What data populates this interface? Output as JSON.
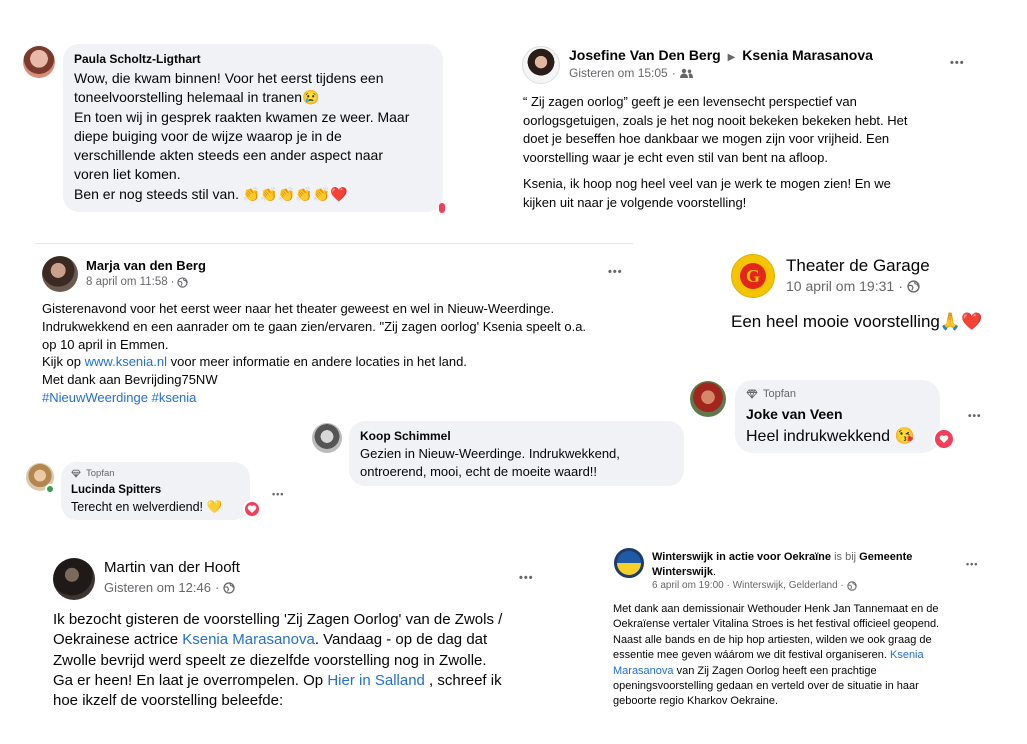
{
  "paula": {
    "name": "Paula Scholtz-Ligthart",
    "lines": [
      "Wow, die kwam binnen! Voor het eerst tijdens een",
      "toneelvoorstelling helemaal in tranen😢",
      "En toen wij in gesprek raakten kwamen ze weer. Maar",
      "diepe buiging voor de wijze waarop je in de",
      "verschillende akten steeds een ander aspect naar",
      "voren liet komen.",
      "Ben er nog steeds stil van. 👏👏👏👏👏❤️"
    ]
  },
  "josefine": {
    "author": "Josefine Van Den Berg",
    "target": "Ksenia Marasanova",
    "time": "Gisteren om 15:05",
    "dots": "•••",
    "lines": [
      "“ Zij zagen oorlog” geeft je een levensecht perspectief van",
      "oorlogsgetuigen, zoals je het nog nooit bekeken bekeken hebt. Het",
      "doet je beseffen hoe dankbaar we mogen zijn voor vrijheid. Een",
      "voorstelling waar je echt even stil van bent na afloop."
    ],
    "lines2": [
      "Ksenia, ik hoop nog heel veel van je werk te mogen zien! En we",
      "kijken uit naar je volgende voorstelling!"
    ]
  },
  "marja": {
    "name": "Marja van den Berg",
    "time": "8 april om 11:58",
    "dots": "•••",
    "line1": "Gisterenavond voor het eerst weer naar het theater geweest en wel in Nieuw-Weerdinge.",
    "line2": "Indrukwekkend en een aanrader om te gaan zien/ervaren. \"Zij zagen oorlog' Ksenia speelt o.a.",
    "line3": "op 10 april in Emmen.",
    "line4_pre": "Kijk op ",
    "line4_link": "www.ksenia.nl",
    "line4_post": " voor meer informatie en andere locaties in het land.",
    "line5": "Met dank aan Bevrijding75NW",
    "hashtags": "#NieuwWeerdinge #ksenia"
  },
  "theater": {
    "name": "Theater de Garage",
    "time": "10 april om 19:31",
    "text": "Een heel mooie voorstelling🙏❤️"
  },
  "joke": {
    "badge": "Topfan",
    "name": "Joke van Veen",
    "text": "Heel indrukwekkend 😘",
    "dots": "•••"
  },
  "koop": {
    "name": "Koop Schimmel",
    "line1": "Gezien in Nieuw-Weerdinge. Indrukwekkend,",
    "line2": "ontroerend, mooi, echt de moeite waard!!"
  },
  "lucinda": {
    "badge": "Topfan",
    "name": "Lucinda Spitters",
    "text": "Terecht en welverdiend! 💛",
    "dots": "•••"
  },
  "martin": {
    "name": "Martin van der Hooft",
    "time": "Gisteren om 12:46",
    "dots": "•••",
    "line1": "Ik bezocht gisteren de voorstelling 'Zij Zagen Oorlog' van de Zwols /",
    "line2_pre": "Oekrainese actrice ",
    "line2_link": "Ksenia Marasanova",
    "line2_post": ". Vandaag  - op de dag dat",
    "line3": "Zwolle bevrijd werd speelt ze diezelfde voorstelling nog in Zwolle.",
    "line4_pre": "Ga er heen! En laat je overrompelen. Op ",
    "line4_link": "Hier in Salland",
    "line4_post": " , schreef ik",
    "line5": "hoe ikzelf de voorstelling beleefde:"
  },
  "winterswijk": {
    "page": "Winterswijk in actie voor Oekraïne",
    "is_bij": " is bij ",
    "place": "Gemeente",
    "place2": "Winterswijk",
    "meta": "6 april om 19:00 · Winterswijk, Gelderland ·",
    "dots": "•••",
    "line1": "Met dank aan demissionair Wethouder Henk Jan Tannemaat en de",
    "line2": "Oekraïense vertaler Vitalina Stroes is het festival officieel geopend.",
    "line3": "Naast alle bands en de hip hop artiesten, wilden we ook graag de",
    "line4_pre": "essentie mee geven wáárom we dit festival organiseren. ",
    "line4_link": "Ksenia",
    "line5_link": "Marasanova",
    "line5_post": " van Zij Zagen Oorlog heeft een prachtige",
    "line6": "openingsvoorstelling gedaan en verteld over de situatie in haar",
    "line7": "geboorte regio Kharkov Oekraine."
  },
  "colors": {
    "link": "#216fdb",
    "bubble": "#f0f2f5",
    "meta": "#65676b",
    "love": "#f33e58"
  }
}
